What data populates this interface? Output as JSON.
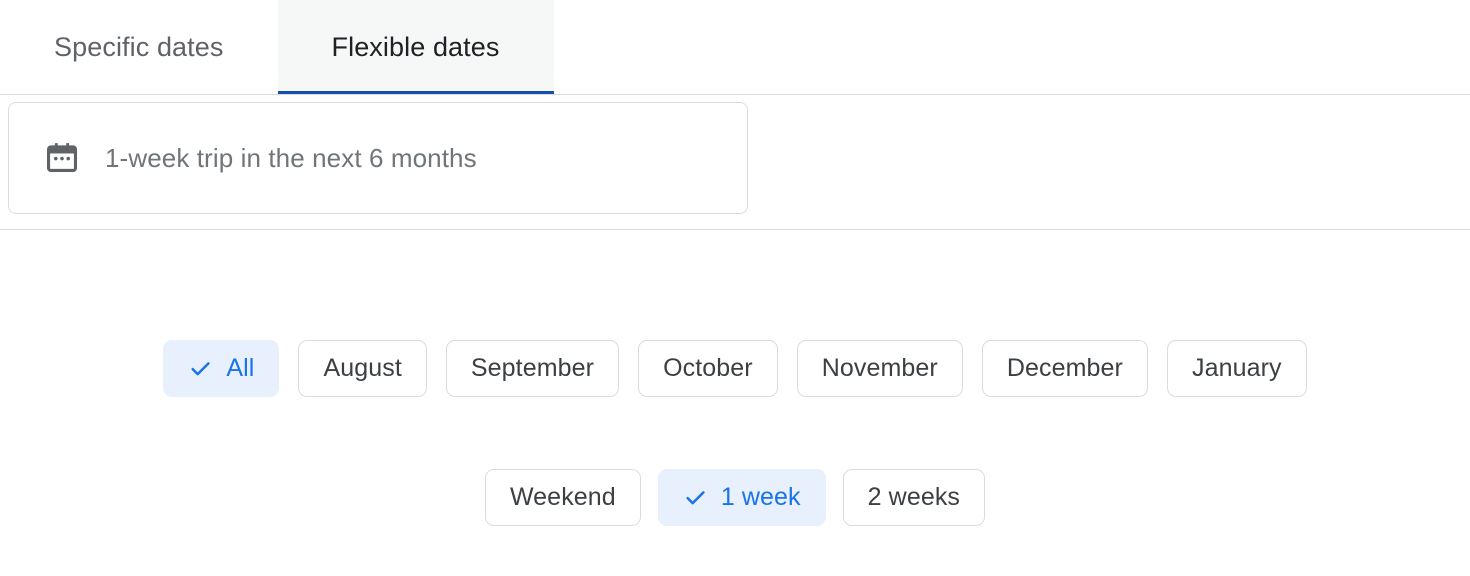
{
  "colors": {
    "accent_blue": "#1a73e8",
    "active_tab_underline": "#174ea6",
    "selected_chip_bg": "#e8f0fe",
    "border_gray": "#dadce0",
    "muted_text": "#5f6368",
    "field_text": "#70757a",
    "chip_text": "#3c4043",
    "active_tab_bg": "#f6f7f7",
    "icon_gray": "#5f6368",
    "page_bg": "#ffffff"
  },
  "tabs": [
    {
      "label": "Specific dates",
      "active": false
    },
    {
      "label": "Flexible dates",
      "active": true
    }
  ],
  "date_field": {
    "icon": "calendar-icon",
    "value": "1-week trip in the next 6 months"
  },
  "month_chips": [
    {
      "label": "All",
      "selected": true,
      "icon": "check-icon"
    },
    {
      "label": "August",
      "selected": false,
      "icon": ""
    },
    {
      "label": "September",
      "selected": false,
      "icon": ""
    },
    {
      "label": "October",
      "selected": false,
      "icon": ""
    },
    {
      "label": "November",
      "selected": false,
      "icon": ""
    },
    {
      "label": "December",
      "selected": false,
      "icon": ""
    },
    {
      "label": "January",
      "selected": false,
      "icon": ""
    }
  ],
  "duration_chips": [
    {
      "label": "Weekend",
      "selected": false,
      "icon": ""
    },
    {
      "label": "1 week",
      "selected": true,
      "icon": "check-icon"
    },
    {
      "label": "2 weeks",
      "selected": false,
      "icon": ""
    }
  ]
}
